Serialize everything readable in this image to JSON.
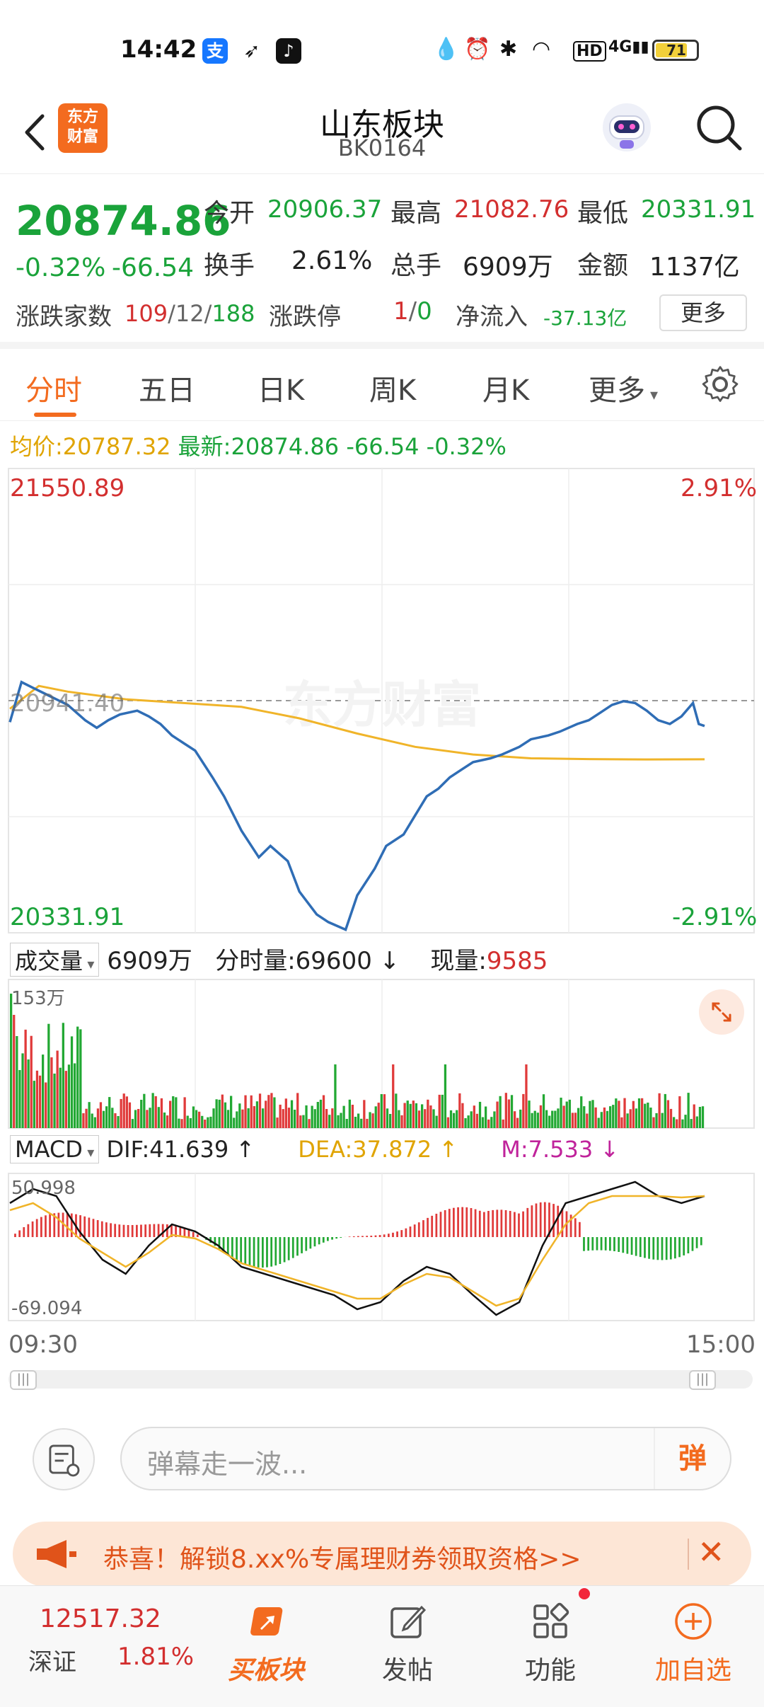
{
  "status_bar": {
    "time": "14:42",
    "apps": [
      "alipay-icon",
      "feather-icon",
      "tiktok-icon"
    ],
    "battery": "71",
    "network": "4G"
  },
  "header": {
    "logo_line1": "东方",
    "logo_line2": "财富",
    "title": "山东板块",
    "code": "BK0164"
  },
  "quote": {
    "price": "20874.86",
    "change_pct": "-0.32%",
    "change": "-66.54",
    "open_label": "今开",
    "open": "20906.37",
    "high_label": "最高",
    "high": "21082.76",
    "low_label": "最低",
    "low": "20331.91",
    "turnover_label": "换手",
    "turnover": "2.61%",
    "volume_label": "总手",
    "volume": "6909万",
    "amount_label": "金额",
    "amount": "1137亿",
    "updown_label": "涨跌家数",
    "up": "109",
    "flat": "12",
    "down": "188",
    "limit_label": "涨跌停",
    "limit_up": "1",
    "limit_down": "0",
    "netflow_label": "净流入",
    "netflow": "-37.13亿",
    "more": "更多"
  },
  "tabs": [
    "分时",
    "五日",
    "日K",
    "周K",
    "月K",
    "更多"
  ],
  "avg_line": {
    "avg_label": "均价:",
    "avg": "20787.32",
    "latest_label": "最新:",
    "latest": "20874.86",
    "chg": "-66.54",
    "pct": "-0.32%"
  },
  "chart_labels": {
    "top_left": "21550.89",
    "top_right": "2.91%",
    "mid": "20941.40",
    "bottom_left": "20331.91",
    "bottom_right": "-2.91%",
    "watermark": "东方财富",
    "x_start": "09:30",
    "x_end": "15:00"
  },
  "volume_bar": {
    "selector": "成交量",
    "total": "6909万",
    "tick_label": "分时量:",
    "tick": "69600",
    "now_label": "现量:",
    "now": "9585",
    "max": "153万"
  },
  "macd_bar": {
    "selector": "MACD",
    "dif": "DIF:41.639",
    "dea": "DEA:37.872",
    "m": "M:7.533",
    "max": "50.998",
    "min": "-69.094"
  },
  "danmaku": {
    "placeholder": "弹幕走一波...",
    "button": "弹"
  },
  "promo": {
    "text": "恭喜！解锁8.xx%专属理财券领取资格>>"
  },
  "bottom_nav": {
    "index_value": "12517.32",
    "index_name": "深证",
    "index_pct": "1.81%",
    "items": [
      "买板块",
      "发帖",
      "功能",
      "加自选"
    ]
  },
  "chart_data": [
    {
      "type": "line",
      "title": "",
      "x_range": [
        "09:30",
        "15:00"
      ],
      "ylim": [
        20331.91,
        21550.89
      ],
      "reference": 20941.4,
      "series": [
        {
          "name": "最新",
          "x": [
            0,
            4,
            8,
            12,
            16,
            20,
            26,
            30,
            34,
            38,
            44,
            48,
            52,
            56,
            60,
            64,
            70,
            74,
            80,
            86,
            90,
            96,
            100,
            106,
            110,
            116,
            120,
            126,
            130,
            136,
            140,
            144,
            148,
            152,
            156,
            160,
            166,
            170,
            176,
            180,
            186,
            190,
            196,
            200,
            204,
            208,
            212,
            216,
            220,
            224,
            228,
            232,
            236,
            238,
            240
          ],
          "y": [
            20885,
            20990,
            20975,
            20960,
            20945,
            20930,
            20890,
            20870,
            20890,
            20905,
            20915,
            20900,
            20880,
            20850,
            20830,
            20810,
            20740,
            20690,
            20600,
            20530,
            20560,
            20520,
            20440,
            20380,
            20360,
            20340,
            20430,
            20500,
            20560,
            20590,
            20640,
            20690,
            20710,
            20740,
            20760,
            20780,
            20790,
            20800,
            20820,
            20840,
            20850,
            20860,
            20880,
            20890,
            20910,
            20930,
            20940,
            20935,
            20915,
            20890,
            20880,
            20900,
            20935,
            20880,
            20874.86
          ]
        },
        {
          "name": "均价",
          "x": [
            0,
            10,
            20,
            40,
            60,
            80,
            100,
            120,
            140,
            160,
            180,
            200,
            220,
            240
          ],
          "y": [
            20920,
            20980,
            20965,
            20945,
            20935,
            20925,
            20895,
            20855,
            20820,
            20800,
            20790,
            20788,
            20787,
            20787.32
          ]
        }
      ]
    },
    {
      "type": "bar",
      "title": "成交量",
      "ymax": 1530000
    },
    {
      "type": "bar",
      "title": "MACD",
      "ylim": [
        -69.094,
        50.998
      ],
      "dif": 41.639,
      "dea": 37.872,
      "m": 7.533
    }
  ]
}
